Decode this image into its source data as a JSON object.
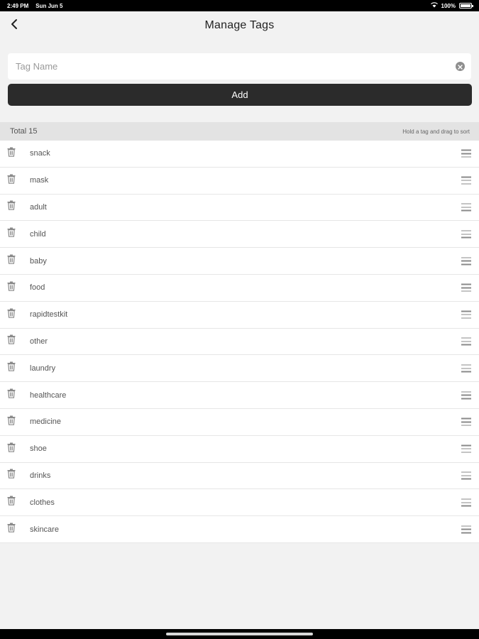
{
  "status_bar": {
    "time": "2:49 PM",
    "date": "Sun Jun 5",
    "battery": "100%"
  },
  "nav": {
    "title": "Manage Tags",
    "back_icon": "chevron-left-icon"
  },
  "input": {
    "placeholder": "Tag Name",
    "value": "",
    "clear_icon": "clear-circle-icon"
  },
  "add_button": {
    "label": "Add"
  },
  "list_header": {
    "total": "Total 15",
    "hint": "Hold a tag and drag to sort"
  },
  "tags": [
    {
      "name": "snack"
    },
    {
      "name": "mask"
    },
    {
      "name": "adult"
    },
    {
      "name": "child"
    },
    {
      "name": "baby"
    },
    {
      "name": "food"
    },
    {
      "name": "rapidtestkit"
    },
    {
      "name": "other"
    },
    {
      "name": "laundry"
    },
    {
      "name": "healthcare"
    },
    {
      "name": "medicine"
    },
    {
      "name": "shoe"
    },
    {
      "name": "drinks"
    },
    {
      "name": "clothes"
    },
    {
      "name": "skincare"
    }
  ],
  "colors": {
    "background": "#f2f2f2",
    "button": "#2b2b2b",
    "header": "#e3e3e3"
  }
}
